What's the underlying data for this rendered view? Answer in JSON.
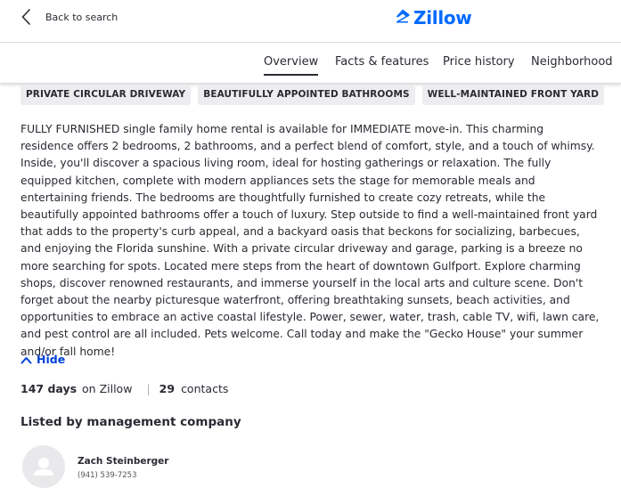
{
  "header": {
    "back_label": "Back to search",
    "logo_text": "Zillow",
    "brand_color": "#006aff",
    "back_icon": "chevron-left-icon"
  },
  "tabs": [
    {
      "label": "Overview",
      "active": true
    },
    {
      "label": "Facts & features",
      "active": false
    },
    {
      "label": "Price history",
      "active": false
    },
    {
      "label": "Neighborhood",
      "active": false
    }
  ],
  "tags": [
    "PRIVATE CIRCULAR DRIVEWAY",
    "BEAUTIFULLY APPOINTED BATHROOMS",
    "WELL-MAINTAINED FRONT YARD"
  ],
  "description": "FULLY FURNISHED single family home rental is available for IMMEDIATE move-in. This charming residence offers 2 bedrooms, 2 bathrooms, and a perfect blend of comfort, style, and a touch of whimsy. Inside, you'll discover a spacious living room, ideal for hosting gatherings or relaxation. The fully equipped kitchen, complete with modern appliances sets the stage for memorable meals and entertaining friends. The bedrooms are thoughtfully furnished to create cozy retreats, while the beautifully appointed bathrooms offer a touch of luxury. Step outside to find a well-maintained front yard that adds to the property's curb appeal, and a backyard oasis that beckons for socializing, barbecues, and enjoying the Florida sunshine. With a private circular driveway and garage, parking is a breeze no more searching for spots. Located mere steps from the heart of downtown Gulfport. Explore charming shops, discover renowned restaurants, and immerse yourself in the local arts and culture scene. Don't forget about the nearby picturesque waterfront, offering breathtaking sunsets, beach activities, and opportunities to embrace an active coastal lifestyle. Power, sewer, water, trash, cable TV, wifi, lawn care, and pest control are all included. Pets welcome. Call today and make the \"Gecko House\" your summer and/or fall home!",
  "hide": {
    "label": "Hide",
    "icon": "chevron-up-icon",
    "color": "#0041d9"
  },
  "stats": {
    "days_value": "147 days",
    "days_suffix": "on Zillow",
    "separator": "|",
    "contacts_value": "29",
    "contacts_label": "contacts"
  },
  "listed_by": {
    "heading": "Listed by management company",
    "agent_name": "Zach Steinberger",
    "agent_phone": "(941) 539-7253",
    "avatar_icon": "user-placeholder-icon"
  }
}
